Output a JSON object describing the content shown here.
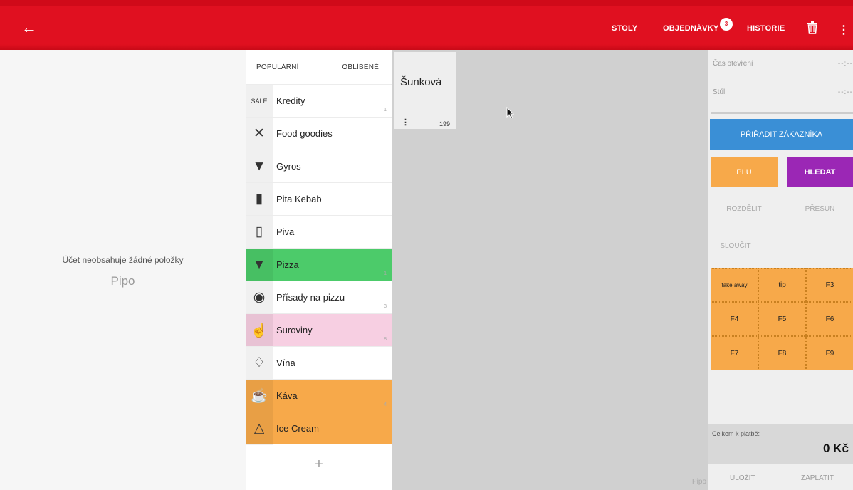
{
  "topbar": {
    "back_icon": "arrow-left-icon",
    "nav": [
      "STOLY",
      "OBJEDNÁVKY",
      "HISTORIE"
    ],
    "orders_badge": "3",
    "trash_icon": "trash-icon",
    "menu_icon": "more-vert-icon",
    "color": "#e01020"
  },
  "left": {
    "empty_message": "Účet neobsahuje žádné položky",
    "user": "Pipo"
  },
  "categories": {
    "tabs": [
      "POPULÁRNÍ",
      "OBLÍBENÉ"
    ],
    "items": [
      {
        "label": "Kredity",
        "icon": "sale-tag-icon",
        "count": "1",
        "color": "#ffffff"
      },
      {
        "label": "Food goodies",
        "icon": "utensils-icon",
        "count": "",
        "color": "#ffffff"
      },
      {
        "label": "Gyros",
        "icon": "gyros-icon",
        "count": "",
        "color": "#ffffff"
      },
      {
        "label": "Pita Kebab",
        "icon": "kebab-icon",
        "count": "",
        "color": "#ffffff"
      },
      {
        "label": "Piva",
        "icon": "bottle-icon",
        "count": "",
        "color": "#ffffff"
      },
      {
        "label": "Pizza",
        "icon": "pizza-slice-icon",
        "count": "1",
        "color": "#4ccb6a"
      },
      {
        "label": "Přísady na pizzu",
        "icon": "pizza-icon",
        "count": "3",
        "color": "#ffffff"
      },
      {
        "label": "Suroviny",
        "icon": "thumbs-up-icon",
        "count": "8",
        "color": "#f7cfe2"
      },
      {
        "label": "Vína",
        "icon": "wine-glasses-icon",
        "count": "",
        "color": "#ffffff"
      },
      {
        "label": "Káva",
        "icon": "coffee-icon",
        "count": "4",
        "color": "#f7a94a"
      },
      {
        "label": "Ice Cream",
        "icon": "ice-cream-icon",
        "count": "",
        "color": "#f7a94a"
      }
    ],
    "add_label": "+"
  },
  "products": {
    "items": [
      {
        "name": "Šunková",
        "price": "199"
      }
    ],
    "footer": "Pipo"
  },
  "panel": {
    "open_time_label": "Čas otevření",
    "open_time_value": "--:--",
    "table_label": "Stůl",
    "table_value": "--:--",
    "assign_customer": "PŘIŘADIT ZÁKAZNÍKA",
    "plu": "PLU",
    "search": "HLEDAT",
    "split": "ROZDĚLIT",
    "move": "PŘESUN",
    "merge": "SLOUČIT",
    "function_keys": [
      "take away",
      "tip",
      "F3",
      "F4",
      "F5",
      "F6",
      "F7",
      "F8",
      "F9"
    ],
    "total_label": "Celkem k platbě:",
    "total_value": "0 Kč",
    "save": "ULOŽIT",
    "pay": "ZAPLATIT"
  }
}
